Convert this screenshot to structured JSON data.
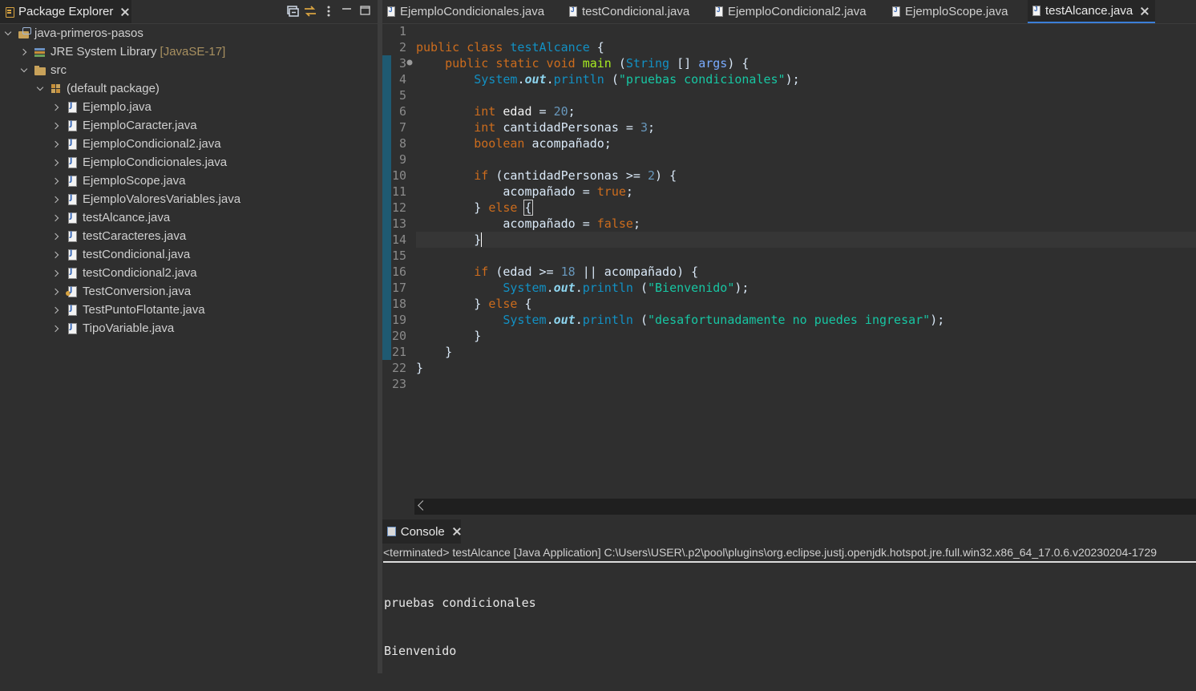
{
  "explorer": {
    "tab_label": "Package Explorer",
    "toolbar": [
      "collapse-all-icon",
      "link-with-editor-icon",
      "view-menu-icon",
      "minimize-icon",
      "maximize-icon"
    ],
    "project": "java-primeros-pasos",
    "jre_label": "JRE System Library",
    "jre_version": "[JavaSE-17]",
    "src_label": "src",
    "package_label": "(default package)",
    "files": [
      "Ejemplo.java",
      "EjemploCaracter.java",
      "EjemploCondicional2.java",
      "EjemploCondicionales.java",
      "EjemploScope.java",
      "EjemploValoresVariables.java",
      "testAlcance.java",
      "testCaracteres.java",
      "testCondicional.java",
      "testCondicional2.java",
      "TestConversion.java",
      "TestPuntoFlotante.java",
      "TipoVariable.java"
    ]
  },
  "editor": {
    "tabs": [
      "EjemploCondicionales.java",
      "testCondicional.java",
      "EjemploCondicional2.java",
      "EjemploScope.java",
      "testAlcance.java"
    ],
    "active_tab": "testAlcance.java",
    "line_numbers": [
      "1",
      "2",
      "3",
      "4",
      "5",
      "6",
      "7",
      "8",
      "9",
      "10",
      "11",
      "12",
      "13",
      "14",
      "15",
      "16",
      "17",
      "18",
      "19",
      "20",
      "21",
      "22",
      "23"
    ],
    "current_line": 14
  },
  "console": {
    "tab_label": "Console",
    "terminated": "<terminated> testAlcance [Java Application] C:\\Users\\USER\\.p2\\pool\\plugins\\org.eclipse.justj.openjdk.hotspot.jre.full.win32.x86_64_17.0.6.v20230204-1729",
    "output": [
      "pruebas condicionales",
      "Bienvenido"
    ]
  },
  "colors": {
    "background": "#2f2f2f",
    "keyword": "#cc6c1d",
    "string": "#17c6a3",
    "type": "#1290c3",
    "active_tab_underline": "#3b7fd8"
  }
}
